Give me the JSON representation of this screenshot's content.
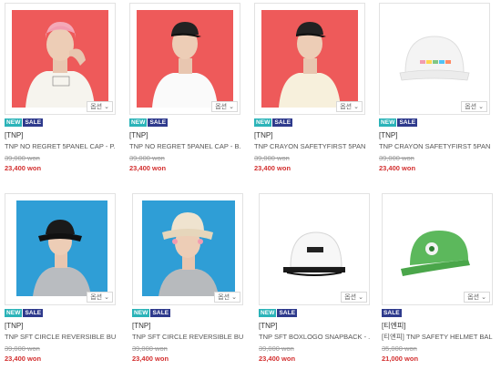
{
  "option_label": "옵션",
  "products": [
    {
      "badges": [
        "NEW",
        "SALE"
      ],
      "brand": "[TNP]",
      "name": "TNP NO REGRET 5PANEL CAP - P...",
      "original_price": "39,000 won",
      "sale_price": "23,400 won",
      "image": "model-pink-cap-red-bg"
    },
    {
      "badges": [
        "NEW",
        "SALE"
      ],
      "brand": "[TNP]",
      "name": "TNP NO REGRET 5PANEL CAP - B...",
      "original_price": "39,000 won",
      "sale_price": "23,400 won",
      "image": "model-black-cap-red-bg"
    },
    {
      "badges": [
        "NEW",
        "SALE"
      ],
      "brand": "[TNP]",
      "name": "TNP CRAYON SAFETYFIRST 5PAN...",
      "original_price": "39,000 won",
      "sale_price": "23,400 won",
      "image": "model-black-cap-red-bg-2"
    },
    {
      "badges": [
        "NEW",
        "SALE"
      ],
      "brand": "[TNP]",
      "name": "TNP CRAYON SAFETYFIRST 5PAN...",
      "original_price": "39,000 won",
      "sale_price": "23,400 won",
      "image": "white-cap-product"
    },
    {
      "badges": [
        "NEW",
        "SALE"
      ],
      "brand": "[TNP]",
      "name": "TNP SFT CIRCLE REVERSIBLE BUC...",
      "original_price": "39,000 won",
      "sale_price": "23,400 won",
      "image": "model-black-bucket-blue-bg"
    },
    {
      "badges": [
        "NEW",
        "SALE"
      ],
      "brand": "[TNP]",
      "name": "TNP SFT CIRCLE REVERSIBLE BUC...",
      "original_price": "39,000 won",
      "sale_price": "23,400 won",
      "image": "model-beige-bucket-blue-bg"
    },
    {
      "badges": [
        "NEW",
        "SALE"
      ],
      "brand": "[TNP]",
      "name": "TNP SFT BOXLOGO SNAPBACK - ...",
      "original_price": "39,000 won",
      "sale_price": "23,400 won",
      "image": "white-snapback-product"
    },
    {
      "badges": [
        "SALE"
      ],
      "brand": "[티엔피]",
      "name": "[티엔피] TNP SAFETY HELMET BAL...",
      "original_price": "35,000 won",
      "sale_price": "21,000 won",
      "image": "green-cap-product"
    }
  ],
  "colors": {
    "new_badge": "#2bb3b8",
    "sale_badge": "#2e3a8c",
    "sale_price": "#d32f2f",
    "red_bg": "#ee5a5a",
    "blue_bg": "#2f9ed6"
  }
}
